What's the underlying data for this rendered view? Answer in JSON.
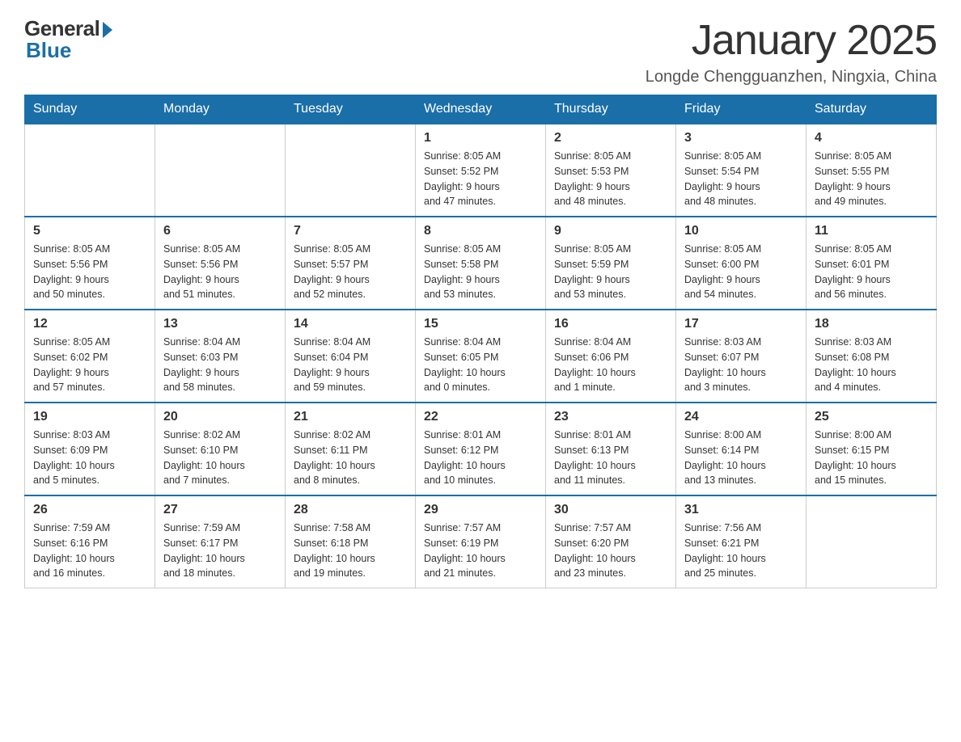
{
  "header": {
    "logo_general": "General",
    "logo_blue": "Blue",
    "month_title": "January 2025",
    "location": "Longde Chengguanzhen, Ningxia, China"
  },
  "days_of_week": [
    "Sunday",
    "Monday",
    "Tuesday",
    "Wednesday",
    "Thursday",
    "Friday",
    "Saturday"
  ],
  "weeks": [
    {
      "days": [
        {
          "number": "",
          "info": ""
        },
        {
          "number": "",
          "info": ""
        },
        {
          "number": "",
          "info": ""
        },
        {
          "number": "1",
          "info": "Sunrise: 8:05 AM\nSunset: 5:52 PM\nDaylight: 9 hours\nand 47 minutes."
        },
        {
          "number": "2",
          "info": "Sunrise: 8:05 AM\nSunset: 5:53 PM\nDaylight: 9 hours\nand 48 minutes."
        },
        {
          "number": "3",
          "info": "Sunrise: 8:05 AM\nSunset: 5:54 PM\nDaylight: 9 hours\nand 48 minutes."
        },
        {
          "number": "4",
          "info": "Sunrise: 8:05 AM\nSunset: 5:55 PM\nDaylight: 9 hours\nand 49 minutes."
        }
      ]
    },
    {
      "days": [
        {
          "number": "5",
          "info": "Sunrise: 8:05 AM\nSunset: 5:56 PM\nDaylight: 9 hours\nand 50 minutes."
        },
        {
          "number": "6",
          "info": "Sunrise: 8:05 AM\nSunset: 5:56 PM\nDaylight: 9 hours\nand 51 minutes."
        },
        {
          "number": "7",
          "info": "Sunrise: 8:05 AM\nSunset: 5:57 PM\nDaylight: 9 hours\nand 52 minutes."
        },
        {
          "number": "8",
          "info": "Sunrise: 8:05 AM\nSunset: 5:58 PM\nDaylight: 9 hours\nand 53 minutes."
        },
        {
          "number": "9",
          "info": "Sunrise: 8:05 AM\nSunset: 5:59 PM\nDaylight: 9 hours\nand 53 minutes."
        },
        {
          "number": "10",
          "info": "Sunrise: 8:05 AM\nSunset: 6:00 PM\nDaylight: 9 hours\nand 54 minutes."
        },
        {
          "number": "11",
          "info": "Sunrise: 8:05 AM\nSunset: 6:01 PM\nDaylight: 9 hours\nand 56 minutes."
        }
      ]
    },
    {
      "days": [
        {
          "number": "12",
          "info": "Sunrise: 8:05 AM\nSunset: 6:02 PM\nDaylight: 9 hours\nand 57 minutes."
        },
        {
          "number": "13",
          "info": "Sunrise: 8:04 AM\nSunset: 6:03 PM\nDaylight: 9 hours\nand 58 minutes."
        },
        {
          "number": "14",
          "info": "Sunrise: 8:04 AM\nSunset: 6:04 PM\nDaylight: 9 hours\nand 59 minutes."
        },
        {
          "number": "15",
          "info": "Sunrise: 8:04 AM\nSunset: 6:05 PM\nDaylight: 10 hours\nand 0 minutes."
        },
        {
          "number": "16",
          "info": "Sunrise: 8:04 AM\nSunset: 6:06 PM\nDaylight: 10 hours\nand 1 minute."
        },
        {
          "number": "17",
          "info": "Sunrise: 8:03 AM\nSunset: 6:07 PM\nDaylight: 10 hours\nand 3 minutes."
        },
        {
          "number": "18",
          "info": "Sunrise: 8:03 AM\nSunset: 6:08 PM\nDaylight: 10 hours\nand 4 minutes."
        }
      ]
    },
    {
      "days": [
        {
          "number": "19",
          "info": "Sunrise: 8:03 AM\nSunset: 6:09 PM\nDaylight: 10 hours\nand 5 minutes."
        },
        {
          "number": "20",
          "info": "Sunrise: 8:02 AM\nSunset: 6:10 PM\nDaylight: 10 hours\nand 7 minutes."
        },
        {
          "number": "21",
          "info": "Sunrise: 8:02 AM\nSunset: 6:11 PM\nDaylight: 10 hours\nand 8 minutes."
        },
        {
          "number": "22",
          "info": "Sunrise: 8:01 AM\nSunset: 6:12 PM\nDaylight: 10 hours\nand 10 minutes."
        },
        {
          "number": "23",
          "info": "Sunrise: 8:01 AM\nSunset: 6:13 PM\nDaylight: 10 hours\nand 11 minutes."
        },
        {
          "number": "24",
          "info": "Sunrise: 8:00 AM\nSunset: 6:14 PM\nDaylight: 10 hours\nand 13 minutes."
        },
        {
          "number": "25",
          "info": "Sunrise: 8:00 AM\nSunset: 6:15 PM\nDaylight: 10 hours\nand 15 minutes."
        }
      ]
    },
    {
      "days": [
        {
          "number": "26",
          "info": "Sunrise: 7:59 AM\nSunset: 6:16 PM\nDaylight: 10 hours\nand 16 minutes."
        },
        {
          "number": "27",
          "info": "Sunrise: 7:59 AM\nSunset: 6:17 PM\nDaylight: 10 hours\nand 18 minutes."
        },
        {
          "number": "28",
          "info": "Sunrise: 7:58 AM\nSunset: 6:18 PM\nDaylight: 10 hours\nand 19 minutes."
        },
        {
          "number": "29",
          "info": "Sunrise: 7:57 AM\nSunset: 6:19 PM\nDaylight: 10 hours\nand 21 minutes."
        },
        {
          "number": "30",
          "info": "Sunrise: 7:57 AM\nSunset: 6:20 PM\nDaylight: 10 hours\nand 23 minutes."
        },
        {
          "number": "31",
          "info": "Sunrise: 7:56 AM\nSunset: 6:21 PM\nDaylight: 10 hours\nand 25 minutes."
        },
        {
          "number": "",
          "info": ""
        }
      ]
    }
  ]
}
